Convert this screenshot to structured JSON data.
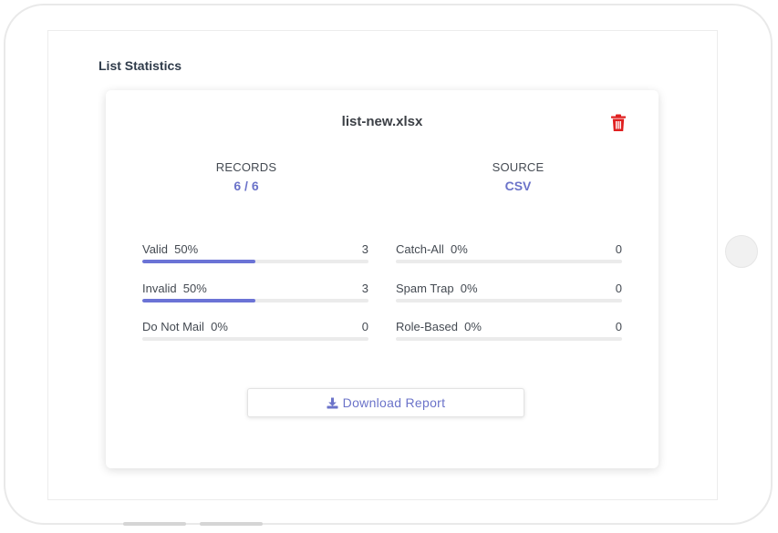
{
  "page": {
    "section_title": "List Statistics"
  },
  "card": {
    "file_name": "list-new.xlsx",
    "delete_icon": "trash-icon",
    "records": {
      "label": "RECORDS",
      "value": "6 / 6"
    },
    "source": {
      "label": "SOURCE",
      "value": "CSV"
    },
    "metrics": {
      "valid": {
        "label": "Valid  50%",
        "count": "3",
        "fraction": 0.5
      },
      "invalid": {
        "label": "Invalid  50%",
        "count": "3",
        "fraction": 0.5
      },
      "do_not_mail": {
        "label": "Do Not Mail  0%",
        "count": "0",
        "fraction": 0
      },
      "catch_all": {
        "label": "Catch-All  0%",
        "count": "0",
        "fraction": 0
      },
      "spam_trap": {
        "label": "Spam Trap  0%",
        "count": "0",
        "fraction": 0
      },
      "role_based": {
        "label": "Role-Based  0%",
        "count": "0",
        "fraction": 0
      }
    },
    "download": {
      "label": "Download Report",
      "icon": "download-icon"
    }
  },
  "colors": {
    "accent": "#6b73c9",
    "bar_fill": "#6b73d6",
    "bar_track": "#ebebeb",
    "delete": "#e02020"
  }
}
